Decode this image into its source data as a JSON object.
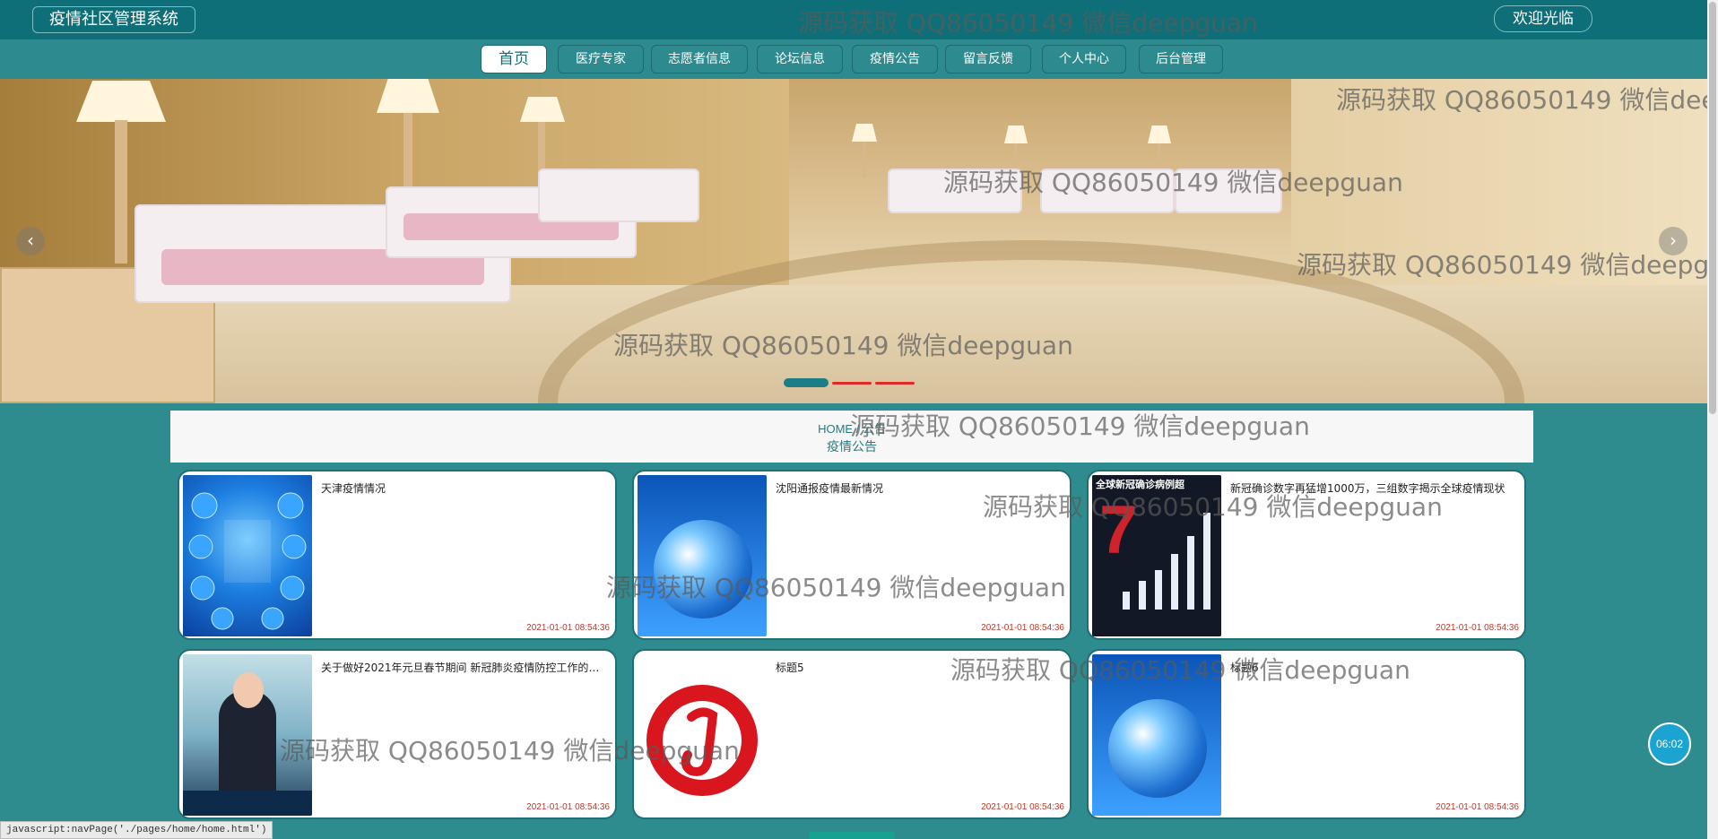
{
  "header": {
    "brand": "疫情社区管理系统",
    "welcome": "欢迎光临"
  },
  "nav": {
    "items": [
      {
        "label": "首页",
        "active": true
      },
      {
        "label": "医疗专家"
      },
      {
        "label": "志愿者信息"
      },
      {
        "label": "论坛信息"
      },
      {
        "label": "疫情公告"
      },
      {
        "label": "留言反馈"
      },
      {
        "label": "个人中心"
      },
      {
        "label": "后台管理"
      }
    ]
  },
  "carousel": {
    "prev_icon": "‹",
    "next_icon": "›",
    "active_slide": 1,
    "slide_count": 3,
    "colors": {
      "active": "#1b7d86",
      "inactive": "#e02a2a"
    }
  },
  "section": {
    "home": "HOME / 公告",
    "title": "疫情公告"
  },
  "cards": [
    {
      "title": "天津疫情情况",
      "date": "2021-01-01 08:54:36",
      "image": "tianjin-infographic"
    },
    {
      "title": "沈阳通报疫情最新情况",
      "date": "2021-01-01 08:54:36",
      "image": "globe"
    },
    {
      "title": "新冠确诊数字再猛增1000万，三组数字揭示全球疫情现状",
      "date": "2021-01-01 08:54:36",
      "image": "global-cases-chart"
    },
    {
      "title": "关于做好2021年元旦春节期间 新冠肺炎疫情防控工作的…",
      "date": "2021-01-01 08:54:36",
      "image": "news-anchor"
    },
    {
      "title": "标题5",
      "date": "2021-01-01 08:54:36",
      "image": "netease-music-logo"
    },
    {
      "title": "标题6",
      "date": "2021-01-01 08:54:36",
      "image": "globe"
    }
  ],
  "card_images": {
    "chart_title": "全球新冠确诊病例超",
    "chart_number": "7"
  },
  "watermark": "源码获取 QQ86050149 微信deepguan",
  "status_link": "javascript:navPage('./pages/home/home.html')",
  "timer": "06:02"
}
